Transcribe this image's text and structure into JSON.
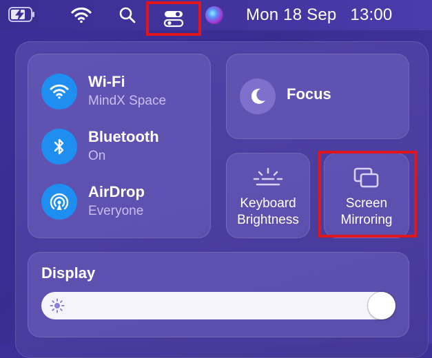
{
  "menubar": {
    "icons": [
      "battery-charging-icon",
      "wifi-icon",
      "search-icon",
      "control-center-icon",
      "siri-icon"
    ],
    "date": "Mon 18 Sep",
    "time": "13:00"
  },
  "control_center": {
    "network": [
      {
        "title": "Wi-Fi",
        "subtitle": "MindX Space",
        "icon": "wifi-icon"
      },
      {
        "title": "Bluetooth",
        "subtitle": "On",
        "icon": "bluetooth-icon"
      },
      {
        "title": "AirDrop",
        "subtitle": "Everyone",
        "icon": "airdrop-icon"
      }
    ],
    "focus": {
      "label": "Focus",
      "icon": "moon-icon"
    },
    "keyboard_brightness": {
      "line1": "Keyboard",
      "line2": "Brightness",
      "icon": "keyboard-brightness-icon"
    },
    "screen_mirroring": {
      "line1": "Screen",
      "line2": "Mirroring",
      "icon": "screen-mirroring-icon"
    },
    "display": {
      "label": "Display",
      "brightness_percent": 100,
      "icon": "sun-icon"
    }
  },
  "colors": {
    "highlight": "#e0161c",
    "network_icon_bg": "#1f8ef1",
    "subtitle": "#c9bff5"
  }
}
